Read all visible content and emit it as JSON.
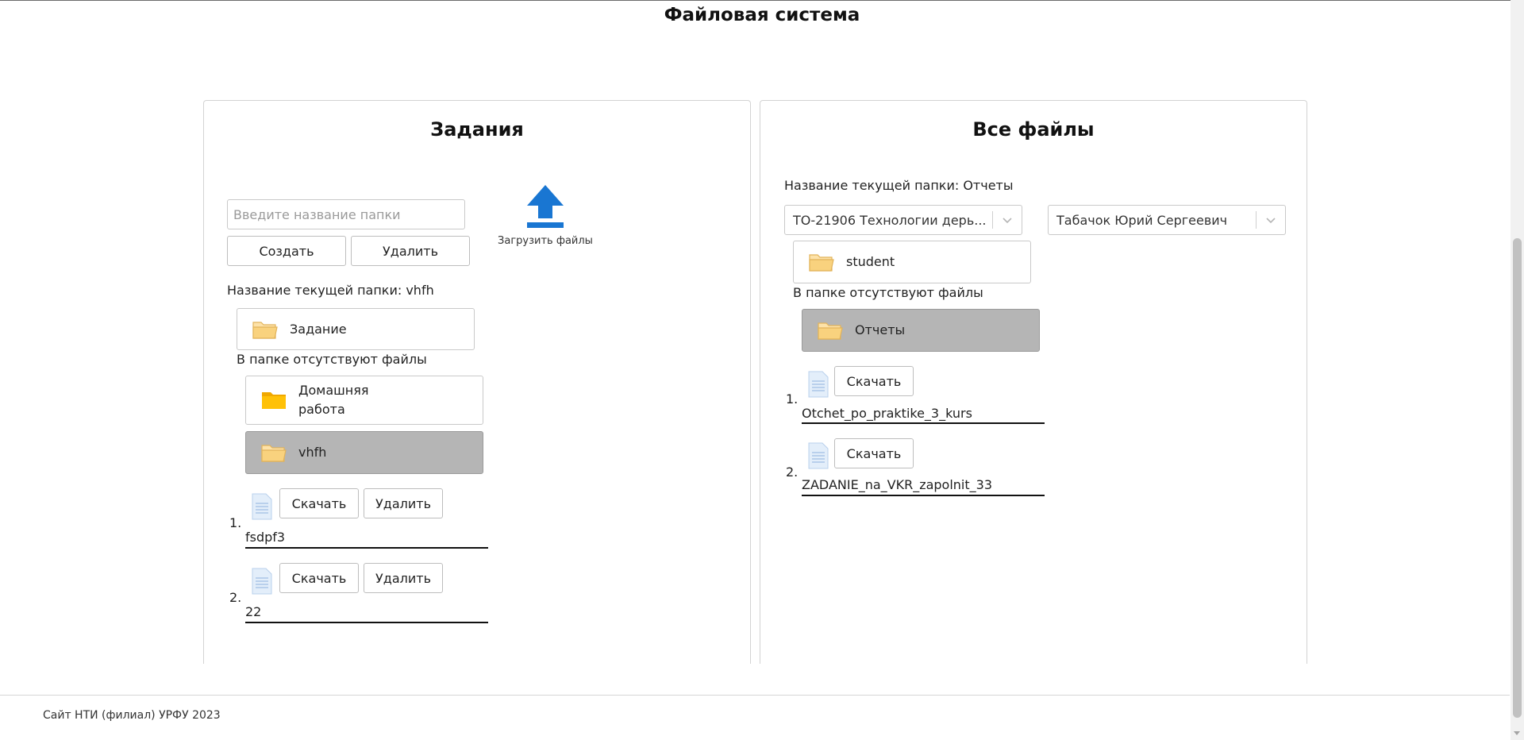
{
  "page": {
    "title": "Файловая система"
  },
  "left": {
    "title": "Задания",
    "folder_input": {
      "placeholder": "Введите название папки",
      "value": ""
    },
    "create_label": "Создать",
    "delete_label": "Удалить",
    "upload_label": "Загрузить файлы",
    "current_folder_text": "Название текущей папки: vhfh",
    "root_folder": "Задание",
    "root_empty_text": "В папке отсутствуют файлы",
    "subfolders": [
      {
        "name": "Домашняя\nработа",
        "active": false
      },
      {
        "name": "vhfh",
        "active": true
      }
    ],
    "files": [
      {
        "num": "1.",
        "name": "fsdpf3",
        "download_label": "Скачать",
        "delete_label": "Удалить"
      },
      {
        "num": "2.",
        "name": "22",
        "download_label": "Скачать",
        "delete_label": "Удалить"
      }
    ]
  },
  "right": {
    "title": "Все файлы",
    "current_folder_text": "Название текущей папки: Отчеты",
    "group_select": "ТО-21906 Технологии дерь...",
    "teacher_select": "Табачок Юрий Сергеевич",
    "root_folder": "student",
    "root_empty_text": "В папке отсутствуют файлы",
    "active_folder": "Отчеты",
    "files": [
      {
        "num": "1.",
        "name": "Otchet_po_praktike_3_kurs",
        "download_label": "Скачать"
      },
      {
        "num": "2.",
        "name": "ZADANIE_na_VKR_zapolnit_33",
        "download_label": "Скачать"
      }
    ]
  },
  "footer": {
    "text": "Сайт НТИ (филиал) УРФУ 2023"
  },
  "colors": {
    "upload_icon": "#1976d2",
    "active_folder_bg": "#b5b5b5",
    "folder_yellow": "#f5b700",
    "folder_outline": "#f7d08a"
  }
}
